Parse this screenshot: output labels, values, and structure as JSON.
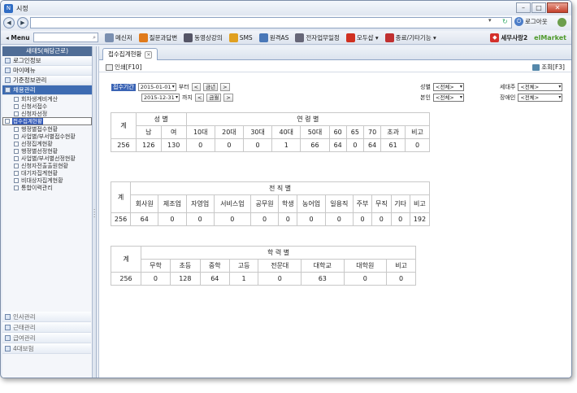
{
  "window": {
    "title": "시정",
    "icon": "N"
  },
  "addressbar": {
    "logout": "로그아웃"
  },
  "menubar": {
    "menu_label": "◂ Menu",
    "tools": [
      {
        "icon": "messenger-icon",
        "label": "메신저",
        "color": "#7a8fb0"
      },
      {
        "icon": "qa-icon",
        "label": "질문과답변",
        "color": "#e07a1b"
      },
      {
        "icon": "video-icon",
        "label": "동영상강의",
        "color": "#556"
      },
      {
        "icon": "sms-icon",
        "label": "SMS",
        "color": "#e0a020"
      },
      {
        "icon": "remote-icon",
        "label": "원격AS",
        "color": "#4a78b8"
      },
      {
        "icon": "schedule-icon",
        "label": "전자업무일정",
        "color": "#667"
      },
      {
        "icon": "cart-icon",
        "label": "모두샵 ▾",
        "color": "#d03020"
      },
      {
        "icon": "exit-icon",
        "label": "종료/기타기능 ▾",
        "color": "#c03030"
      }
    ],
    "tax": "세무사랑2",
    "elmarket": "elMarket"
  },
  "sidebar": {
    "header": "새태5(해당근로)",
    "items": [
      {
        "label": "로그인정보"
      },
      {
        "label": "마이메뉴"
      },
      {
        "label": "기준정보관리"
      },
      {
        "label": "채용관리"
      }
    ],
    "subitems": [
      "회차생계비계산",
      "신청서접수",
      "신청자선정",
      "접수집계현황",
      "행정별접수현황",
      "사업별/부서별접수현황",
      "선정집계현황",
      "행정별선정현황",
      "사업별/부서별선정현황",
      "신청자전출출원현황",
      "대기자집계현황",
      "비대상자집계현황",
      "통합이력관리"
    ],
    "selected_index": 3,
    "bottom": [
      "인사관리",
      "근태관리",
      "급여관리",
      "4대보험"
    ]
  },
  "tab": {
    "label": "접수집계현황"
  },
  "actions": {
    "print": "인쇄[F10]",
    "search": "조회[F3]"
  },
  "filters": {
    "period_label": "접수기간",
    "from": "2015-01-01",
    "from_suffix": "부터",
    "to": "2015-12-31",
    "to_suffix": "까지",
    "this_year": "금년",
    "this_month": "금월",
    "prev": "<",
    "next": ">",
    "gender_label": "성별",
    "gender_value": "<전체>",
    "head_label": "세대주",
    "head_value": "<전체>",
    "self_label": "본인",
    "self_value": "<전체>",
    "disabled_label": "장애인",
    "disabled_value": "<전체>"
  },
  "t1": {
    "total": "계",
    "gender": "성 별",
    "age": "연 령 별",
    "cols": [
      "남",
      "여",
      "10대",
      "20대",
      "30대",
      "40대",
      "50대",
      "60",
      "65",
      "70",
      "초과",
      "비고"
    ],
    "row": [
      "256",
      "126",
      "130",
      "0",
      "0",
      "0",
      "1",
      "66",
      "64",
      "0",
      "64",
      "61",
      "0"
    ]
  },
  "t2": {
    "total": "계",
    "header": "전 직 별",
    "cols": [
      "회사원",
      "제조업",
      "자영업",
      "서비스업",
      "공무원",
      "학생",
      "농어업",
      "일용직",
      "주부",
      "무직",
      "기타",
      "비고"
    ],
    "row": [
      "256",
      "64",
      "0",
      "0",
      "0",
      "0",
      "0",
      "0",
      "0",
      "0",
      "0",
      "0",
      "192"
    ]
  },
  "t3": {
    "total": "계",
    "header": "학 력 별",
    "cols": [
      "무학",
      "초등",
      "중학",
      "고등",
      "전문대",
      "대학교",
      "대학원",
      "비고"
    ],
    "row": [
      "256",
      "0",
      "128",
      "64",
      "1",
      "0",
      "63",
      "0",
      "0"
    ]
  }
}
